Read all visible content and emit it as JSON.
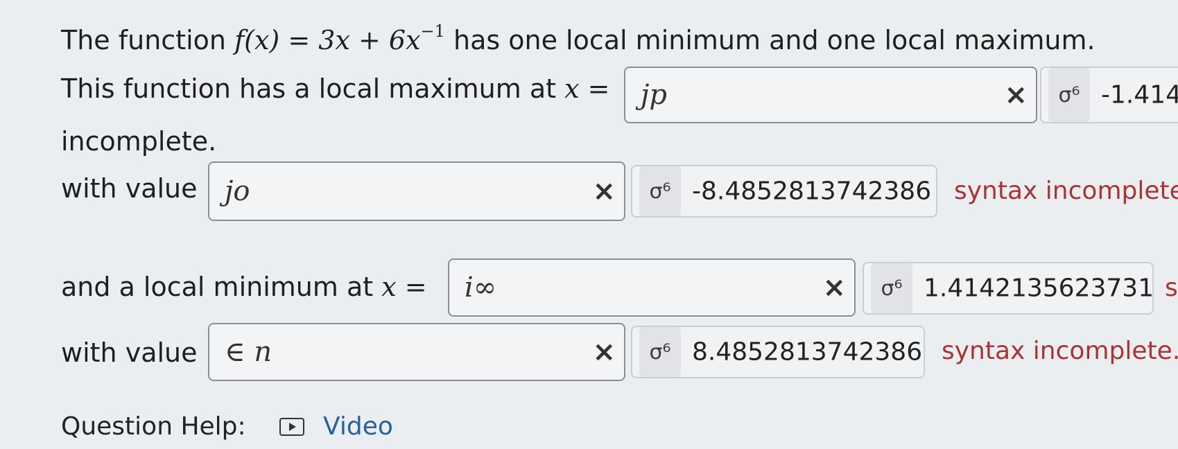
{
  "question": {
    "intro_prefix": "The function",
    "func_name": "f",
    "func_arg": "(x)",
    "eq": "=",
    "term1": "3x",
    "plus": "+",
    "term2": "6x",
    "exponent": "−1",
    "intro_suffix": "has one local minimum and one local maximum."
  },
  "max_x": {
    "label": "This function has a local maximum at",
    "var": "x",
    "eq": "=",
    "input_value": "jp",
    "clear": "×",
    "preview_glyph": "σ⁶",
    "preview_value": "-1.414",
    "status": "incomplete."
  },
  "max_val": {
    "label": "with value",
    "input_value": "jo",
    "clear": "×",
    "preview_glyph": "σ⁶",
    "preview_value": "-8.4852813742386",
    "status": "syntax incomplete"
  },
  "min_x": {
    "label": "and a local minimum at",
    "var": "x",
    "eq": "=",
    "input_value": "i∞",
    "clear": "×",
    "preview_glyph": "σ⁶",
    "preview_value": "1.4142135623731",
    "status": "s"
  },
  "min_val": {
    "label": "with value",
    "input_value": "∈ n",
    "clear": "×",
    "preview_glyph": "σ⁶",
    "preview_value": "8.4852813742386",
    "status": "syntax incomplete."
  },
  "help": {
    "label": "Question Help:",
    "video_icon": "play-icon",
    "video_label": "Video"
  }
}
